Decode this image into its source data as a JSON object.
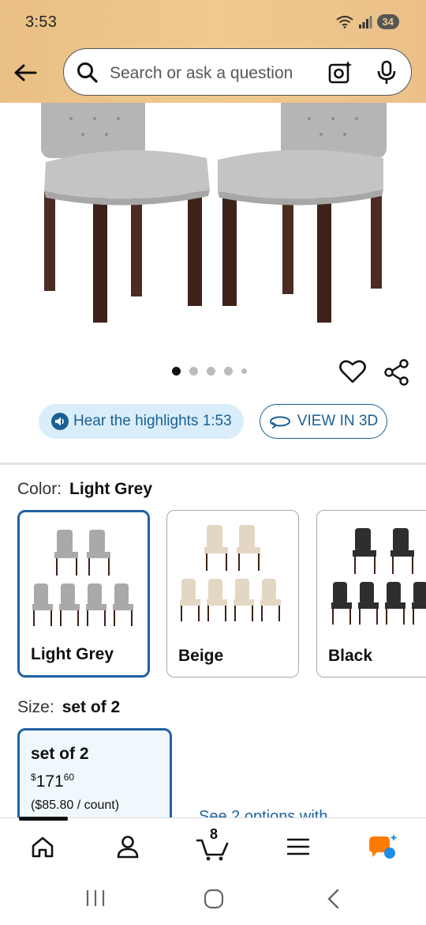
{
  "status_bar": {
    "time": "3:53",
    "battery": "34"
  },
  "search": {
    "placeholder": "Search or ask a question"
  },
  "gallery": {
    "dot_count": 5,
    "active_index": 0
  },
  "actions": {
    "hear_label": "Hear the highlights 1:53",
    "view3d_label": "VIEW IN 3D"
  },
  "color": {
    "label": "Color:",
    "selected": "Light Grey",
    "options": [
      {
        "name": "Light Grey",
        "chair_color": "#a9a9a9"
      },
      {
        "name": "Beige",
        "chair_color": "#e3d7c3"
      },
      {
        "name": "Black",
        "chair_color": "#2e2e30"
      }
    ]
  },
  "size": {
    "label": "Size:",
    "selected": "set of 2",
    "options": [
      {
        "name": "set of 2",
        "price_symbol": "$",
        "price_whole": "171",
        "price_fraction": "60",
        "unit_price": "($85.80 / count)"
      }
    ],
    "see_options": "See 2 options with"
  },
  "bottom_nav": {
    "cart_count": "8"
  },
  "colors": {
    "accent": "#2162a1",
    "header": "#f0c98e",
    "rufus": "#ff7b00"
  }
}
